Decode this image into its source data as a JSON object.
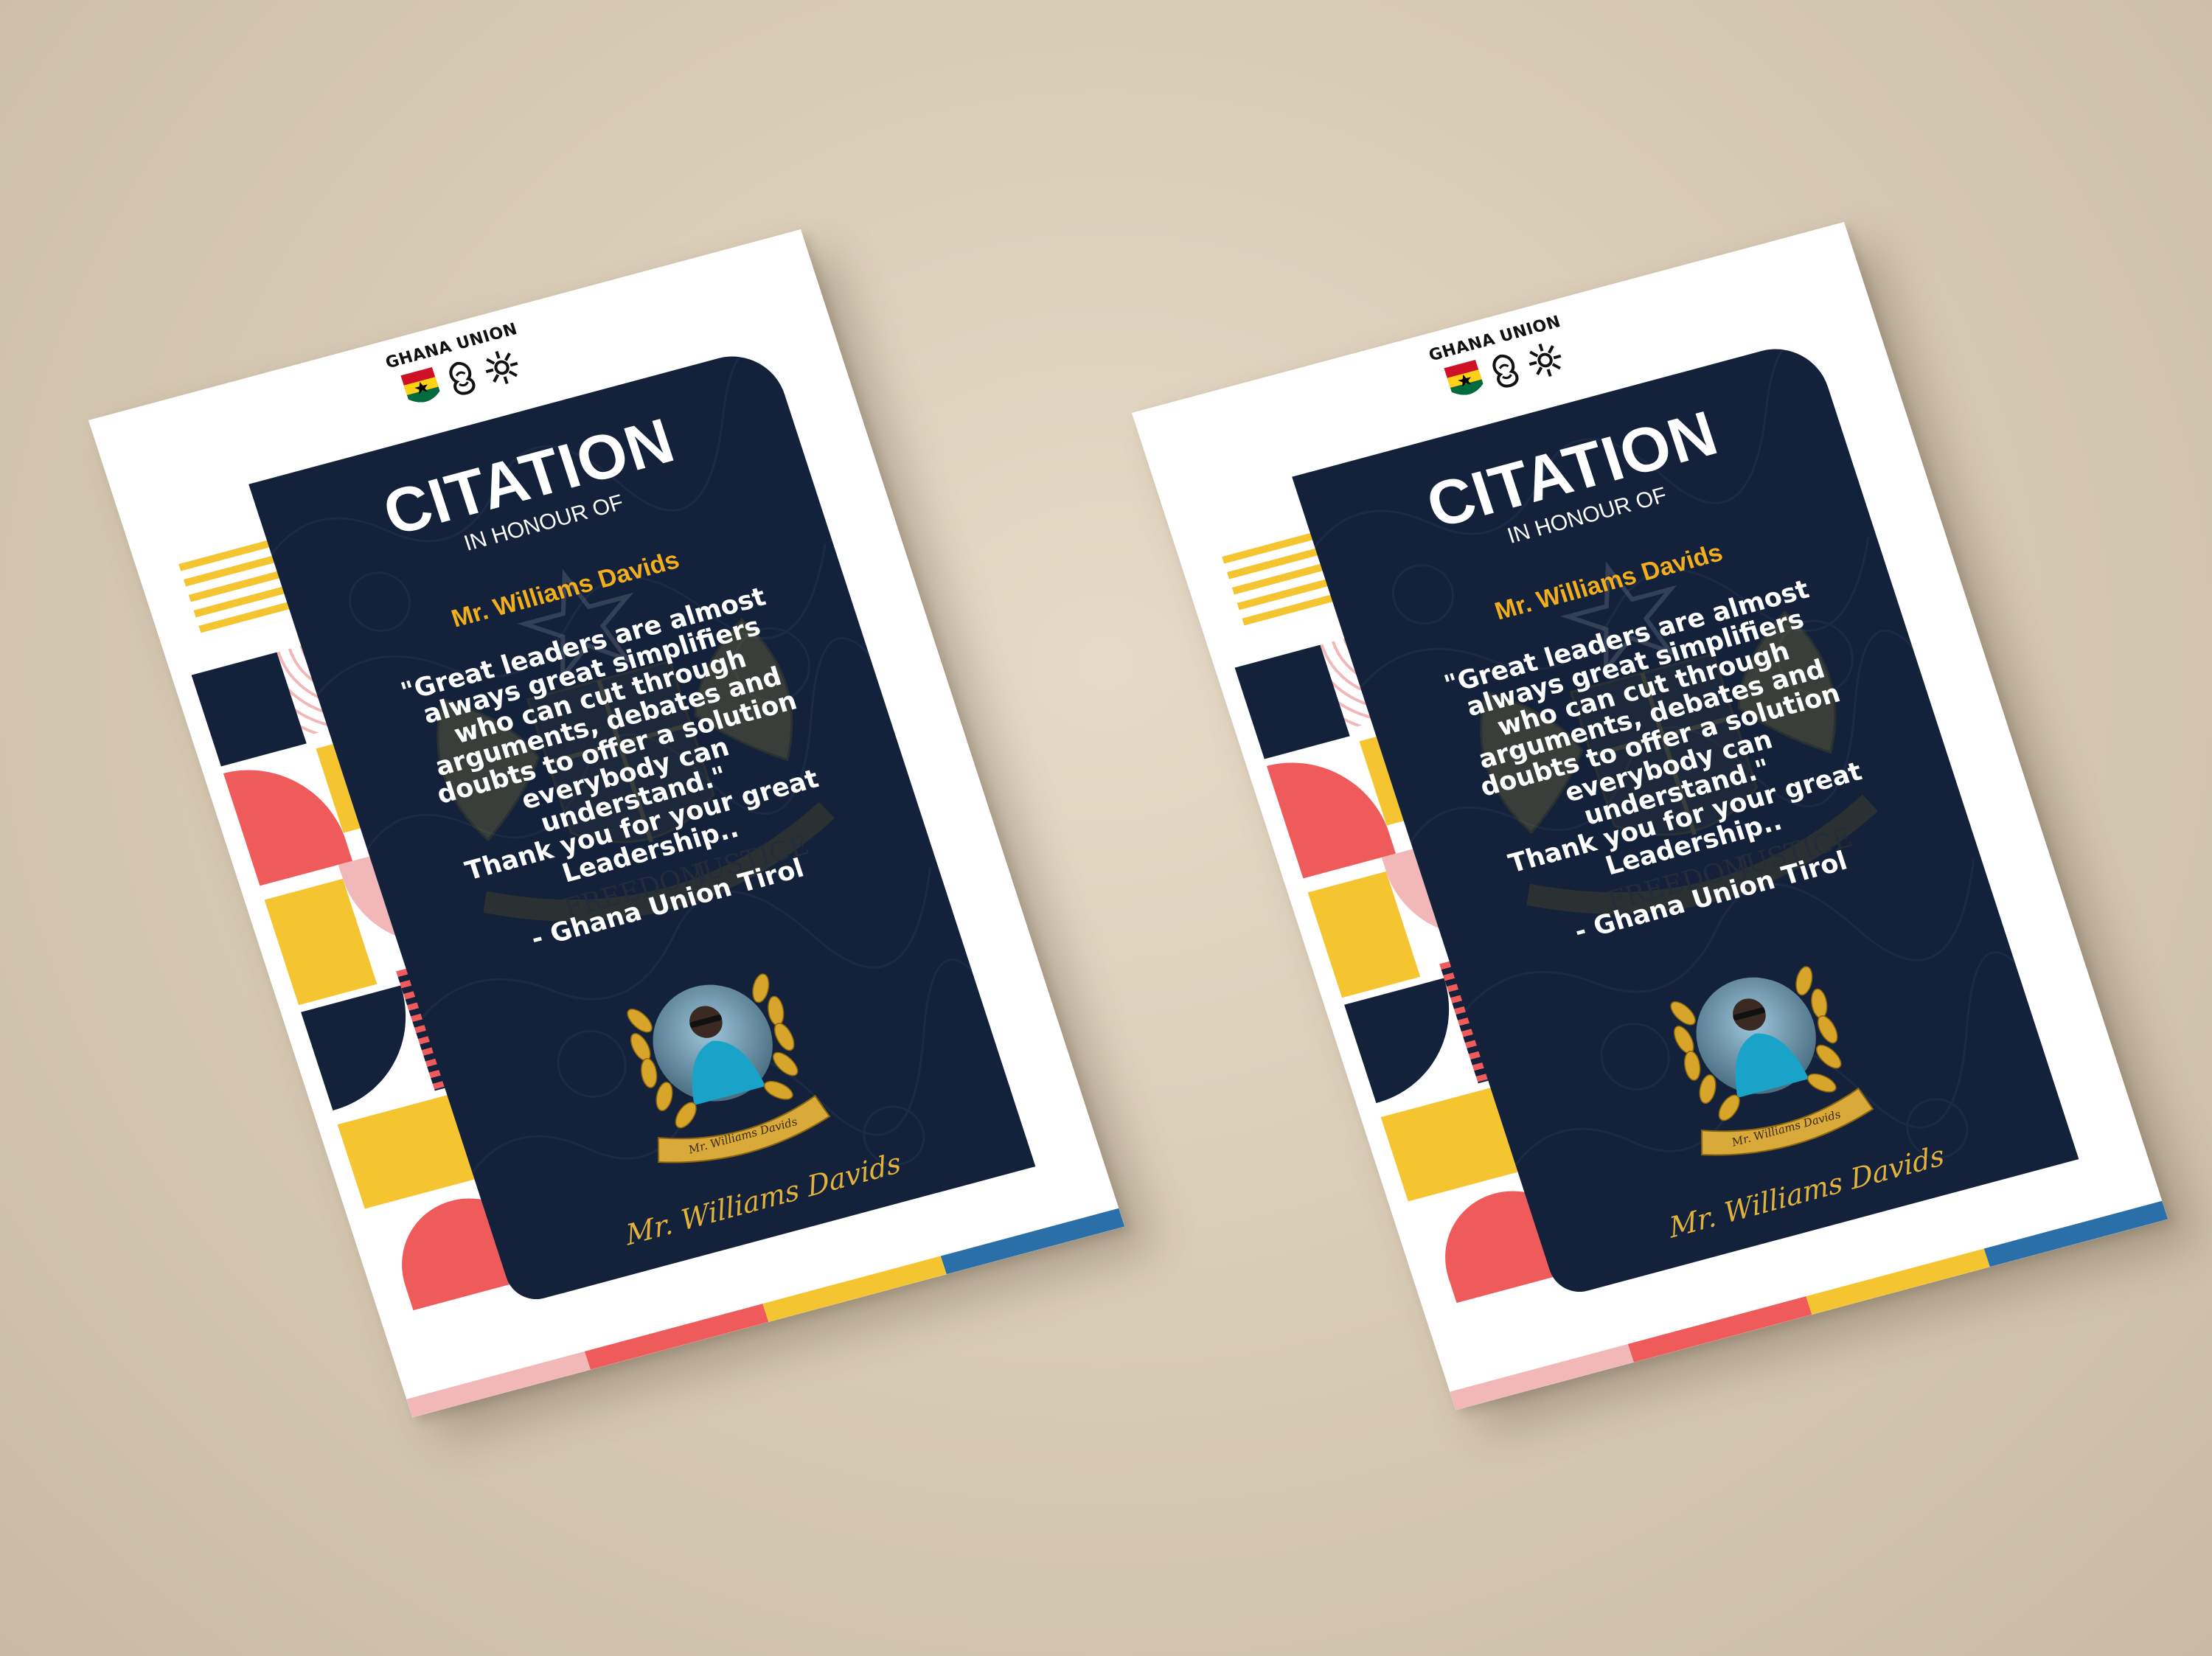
{
  "header": {
    "org_name": "GHANA UNION"
  },
  "card": {
    "title": "CITATION",
    "subtitle": "IN HONOUR OF",
    "honoree": "Mr. Williams Davids",
    "quote_lines": [
      "\"Great leaders are almost",
      "always great simplifiers",
      "who can cut through",
      "arguments, debates and",
      "doubts to offer a solution",
      "everybody can",
      "understand.\"",
      "Thank you for your great",
      "Leadership.."
    ],
    "sign_off": "- Ghana Union Tirol",
    "ribbon_text": "Mr. Williams Davids",
    "signature": "Mr. Williams Davids",
    "motto_words": [
      "FREEDOM",
      "JUSTICE"
    ]
  },
  "colors": {
    "navy": "#13213a",
    "gold": "#f2ae1c",
    "coral": "#ef5b5b",
    "yellow": "#f5c531",
    "blue": "#2a6fa8",
    "pink": "#f2b8b8"
  },
  "icons": [
    "ghana-flag-shield-icon",
    "gye-nyame-icon",
    "adinkra-symbol-icon",
    "laurel-wreath-icon",
    "coat-of-arms-icon"
  ]
}
